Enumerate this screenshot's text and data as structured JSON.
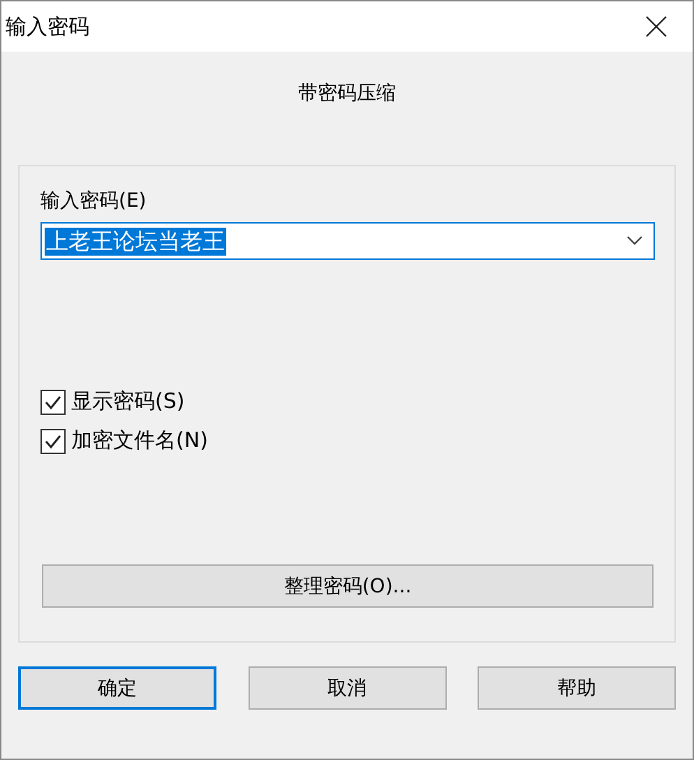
{
  "window": {
    "title": "输入密码"
  },
  "subtitle": "带密码压缩",
  "password": {
    "label": "输入密码(E)",
    "value": "上老王论坛当老王",
    "text_selected": true
  },
  "options": [
    {
      "label": "显示密码(S)",
      "checked": true
    },
    {
      "label": "加密文件名(N)",
      "checked": true
    }
  ],
  "organize_button": "整理密码(O)...",
  "buttons": [
    {
      "label": "确定",
      "default": true
    },
    {
      "label": "取消",
      "default": false
    },
    {
      "label": "帮助",
      "default": false
    }
  ]
}
